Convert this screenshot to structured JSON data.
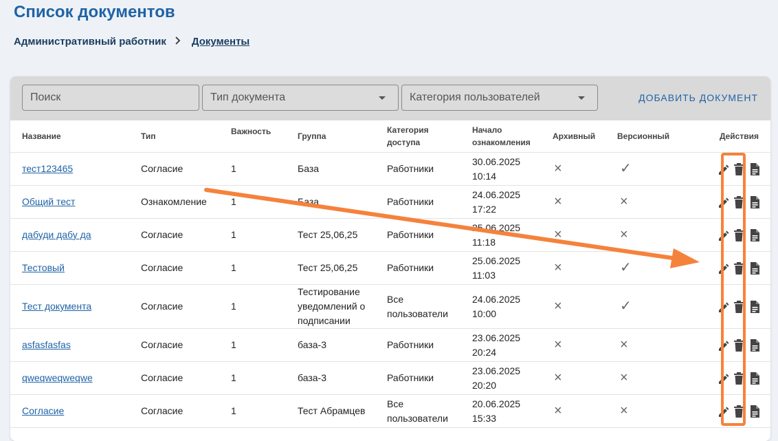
{
  "header": {
    "title": "Список документов",
    "breadcrumb_root": "Административный работник",
    "breadcrumb_sep": ">",
    "breadcrumb_current": "Документы"
  },
  "filters": {
    "search_placeholder": "Поиск",
    "doc_type_placeholder": "Тип документа",
    "user_category_placeholder": "Категория пользователей",
    "add_button": "ДОБАВИТЬ ДОКУМЕНТ"
  },
  "table": {
    "columns": [
      "Название",
      "Тип",
      "Важность",
      "Группа",
      "Категория доступа",
      "Начало ознакомления",
      "Архивный",
      "Версионный",
      "Действия"
    ],
    "rows": [
      {
        "name": "тест123465",
        "type": "Согласие",
        "importance": "1",
        "group": "База",
        "access": "Работники",
        "start_date": "30.06.2025",
        "start_time": "10:14",
        "archived": "×",
        "versioned": "✓"
      },
      {
        "name": "Общий тест",
        "type": "Ознакомление",
        "importance": "1",
        "group": "База",
        "access": "Работники",
        "start_date": "24.06.2025",
        "start_time": "17:22",
        "archived": "×",
        "versioned": "×"
      },
      {
        "name": "дабуди дабу да",
        "type": "Согласие",
        "importance": "1",
        "group": "Тест 25,06,25",
        "access": "Работники",
        "start_date": "25.06.2025",
        "start_time": "11:18",
        "archived": "×",
        "versioned": "×"
      },
      {
        "name": "Тестовый",
        "type": "Согласие",
        "importance": "1",
        "group": "Тест 25,06,25",
        "access": "Работники",
        "start_date": "25.06.2025",
        "start_time": "11:03",
        "archived": "×",
        "versioned": "✓"
      },
      {
        "name": "Тест документа",
        "type": "Согласие",
        "importance": "1",
        "group": "Тестирование уведомлений о подписании",
        "access": "Все пользователи",
        "start_date": "24.06.2025",
        "start_time": "10:00",
        "archived": "×",
        "versioned": "✓"
      },
      {
        "name": "asfasfasfas",
        "type": "Согласие",
        "importance": "1",
        "group": "база-3",
        "access": "Работники",
        "start_date": "23.06.2025",
        "start_time": "20:24",
        "archived": "×",
        "versioned": "×"
      },
      {
        "name": "qweqweqweqwe",
        "type": "Согласие",
        "importance": "1",
        "group": "база-3",
        "access": "Работники",
        "start_date": "23.06.2025",
        "start_time": "20:20",
        "archived": "×",
        "versioned": "×"
      },
      {
        "name": "Согласие",
        "type": "Согласие",
        "importance": "1",
        "group": "Тест Абрамцев",
        "access": "Все пользователи",
        "start_date": "20.06.2025",
        "start_time": "15:33",
        "archived": "×",
        "versioned": "×"
      }
    ]
  },
  "annotation": {
    "arrow_color": "#f5823c",
    "highlight_color": "#f5823c"
  },
  "icons": {
    "edit": "pencil-icon",
    "delete": "trash-icon",
    "view": "document-icon"
  }
}
